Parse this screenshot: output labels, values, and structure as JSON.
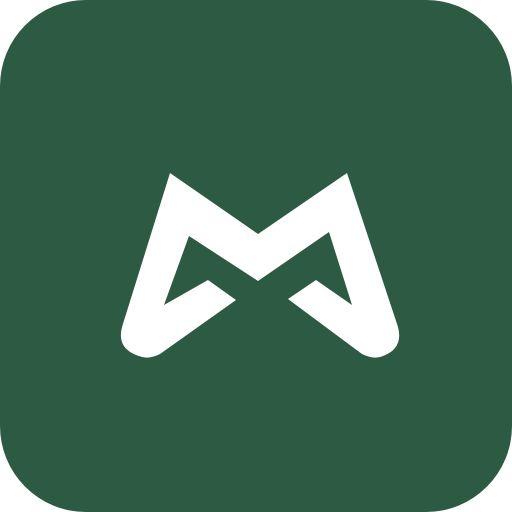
{
  "app_icon": {
    "icon": "m-logo-icon",
    "background_color": "#2d5a43",
    "mark_color": "#ffffff"
  }
}
